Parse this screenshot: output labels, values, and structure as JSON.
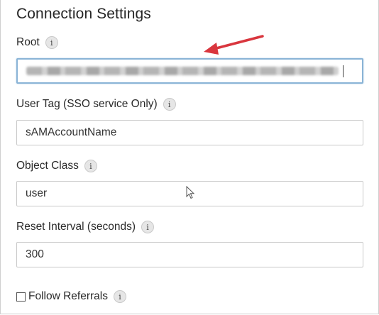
{
  "title": "Connection Settings",
  "fields": {
    "root": {
      "label": "Root",
      "info": "i",
      "value": ""
    },
    "user_tag": {
      "label": "User Tag (SSO service Only)",
      "info": "i",
      "value": "sAMAccountName"
    },
    "object_class": {
      "label": "Object Class",
      "info": "i",
      "value": "user"
    },
    "reset_interval": {
      "label": "Reset Interval (seconds)",
      "info": "i",
      "value": "300"
    }
  },
  "follow_referrals": {
    "label": "Follow Referrals",
    "info": "i",
    "checked": false
  },
  "colors": {
    "accent_arrow": "#d9363e",
    "focus_border": "#8ab4d6"
  },
  "icons": {
    "annotation": "red-arrow-icon",
    "cursor": "mouse-pointer-icon"
  }
}
